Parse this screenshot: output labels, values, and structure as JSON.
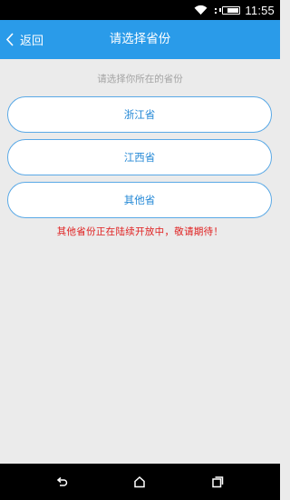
{
  "status_bar": {
    "time": "11:55",
    "icons": [
      "wifi-icon",
      "signal-icon",
      "battery-icon"
    ]
  },
  "header": {
    "back_label": "返回",
    "title": "请选择省份"
  },
  "main": {
    "hint": "请选择你所在的省份",
    "options": [
      {
        "label": "浙江省"
      },
      {
        "label": "江西省"
      },
      {
        "label": "其他省"
      }
    ],
    "notice": "其他省份正在陆续开放中，敬请期待！"
  },
  "nav_bar": {
    "buttons": [
      "back-icon",
      "home-icon",
      "recents-icon"
    ]
  },
  "colors": {
    "header_bg": "#2a9be9",
    "page_bg": "#ebebeb",
    "option_border": "#5aa9e6",
    "option_text": "#2488d6",
    "notice_text": "#e02020",
    "hint_text": "#a4a4a4"
  }
}
